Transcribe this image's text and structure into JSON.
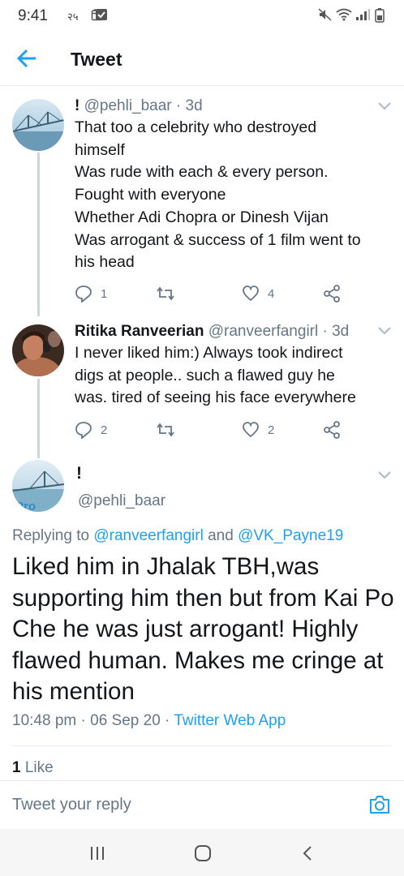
{
  "status_bar": {
    "time": "9:41",
    "extra": "२५",
    "icons": [
      "calendar-icon",
      "check-square-icon",
      "mute-icon",
      "wifi-icon",
      "signal-icon",
      "battery-icon"
    ]
  },
  "header": {
    "title": "Tweet",
    "back_icon": "arrow-left-icon"
  },
  "colors": {
    "accent": "#1da1f2",
    "text": "#14171a",
    "secondary": "#657786",
    "border": "#e6ecf0"
  },
  "tweets": [
    {
      "name": "!",
      "handle": "@pehli_baar",
      "time": "· 3d",
      "text_lines": [
        "That too a celebrity who destroyed",
        "himself",
        "Was rude with each & every person.",
        "Fought with everyone",
        "Whether Adi Chopra or Dinesh Vijan",
        "Was arrogant & success of 1 film went to",
        "his head"
      ],
      "reply_count": "1",
      "retweet_count": "",
      "like_count": "4"
    },
    {
      "name": "Ritika Ranveerian",
      "handle": "@ranveerfangirl",
      "time": "· 3d",
      "text_lines": [
        "I never liked him:) Always took indirect",
        "digs at people.. such a flawed guy he",
        "was. tired of seeing his face everywhere"
      ],
      "reply_count": "2",
      "retweet_count": "",
      "like_count": "2"
    }
  ],
  "main_tweet": {
    "name": "!",
    "handle": "@pehli_baar",
    "avatar_text": "Pro",
    "replying_prefix": "Replying to",
    "replying_user1": "@ranveerfangirl",
    "replying_and": "and",
    "replying_user2": "@VK_Payne19",
    "text": "Liked him in Jhalak TBH,was supporting him then but from Kai Po Che he was just arrogant! Highly flawed human. Makes me cringe at his mention",
    "time": "10:48 pm",
    "date": "06 Sep 20",
    "source": "Twitter Web App",
    "like_count": "1",
    "like_label": "Like"
  },
  "reply_bar": {
    "placeholder": "Tweet your reply",
    "icon": "camera-icon"
  },
  "nav_bar": {
    "icons": [
      "recent-apps-icon",
      "home-icon",
      "back-icon"
    ]
  }
}
